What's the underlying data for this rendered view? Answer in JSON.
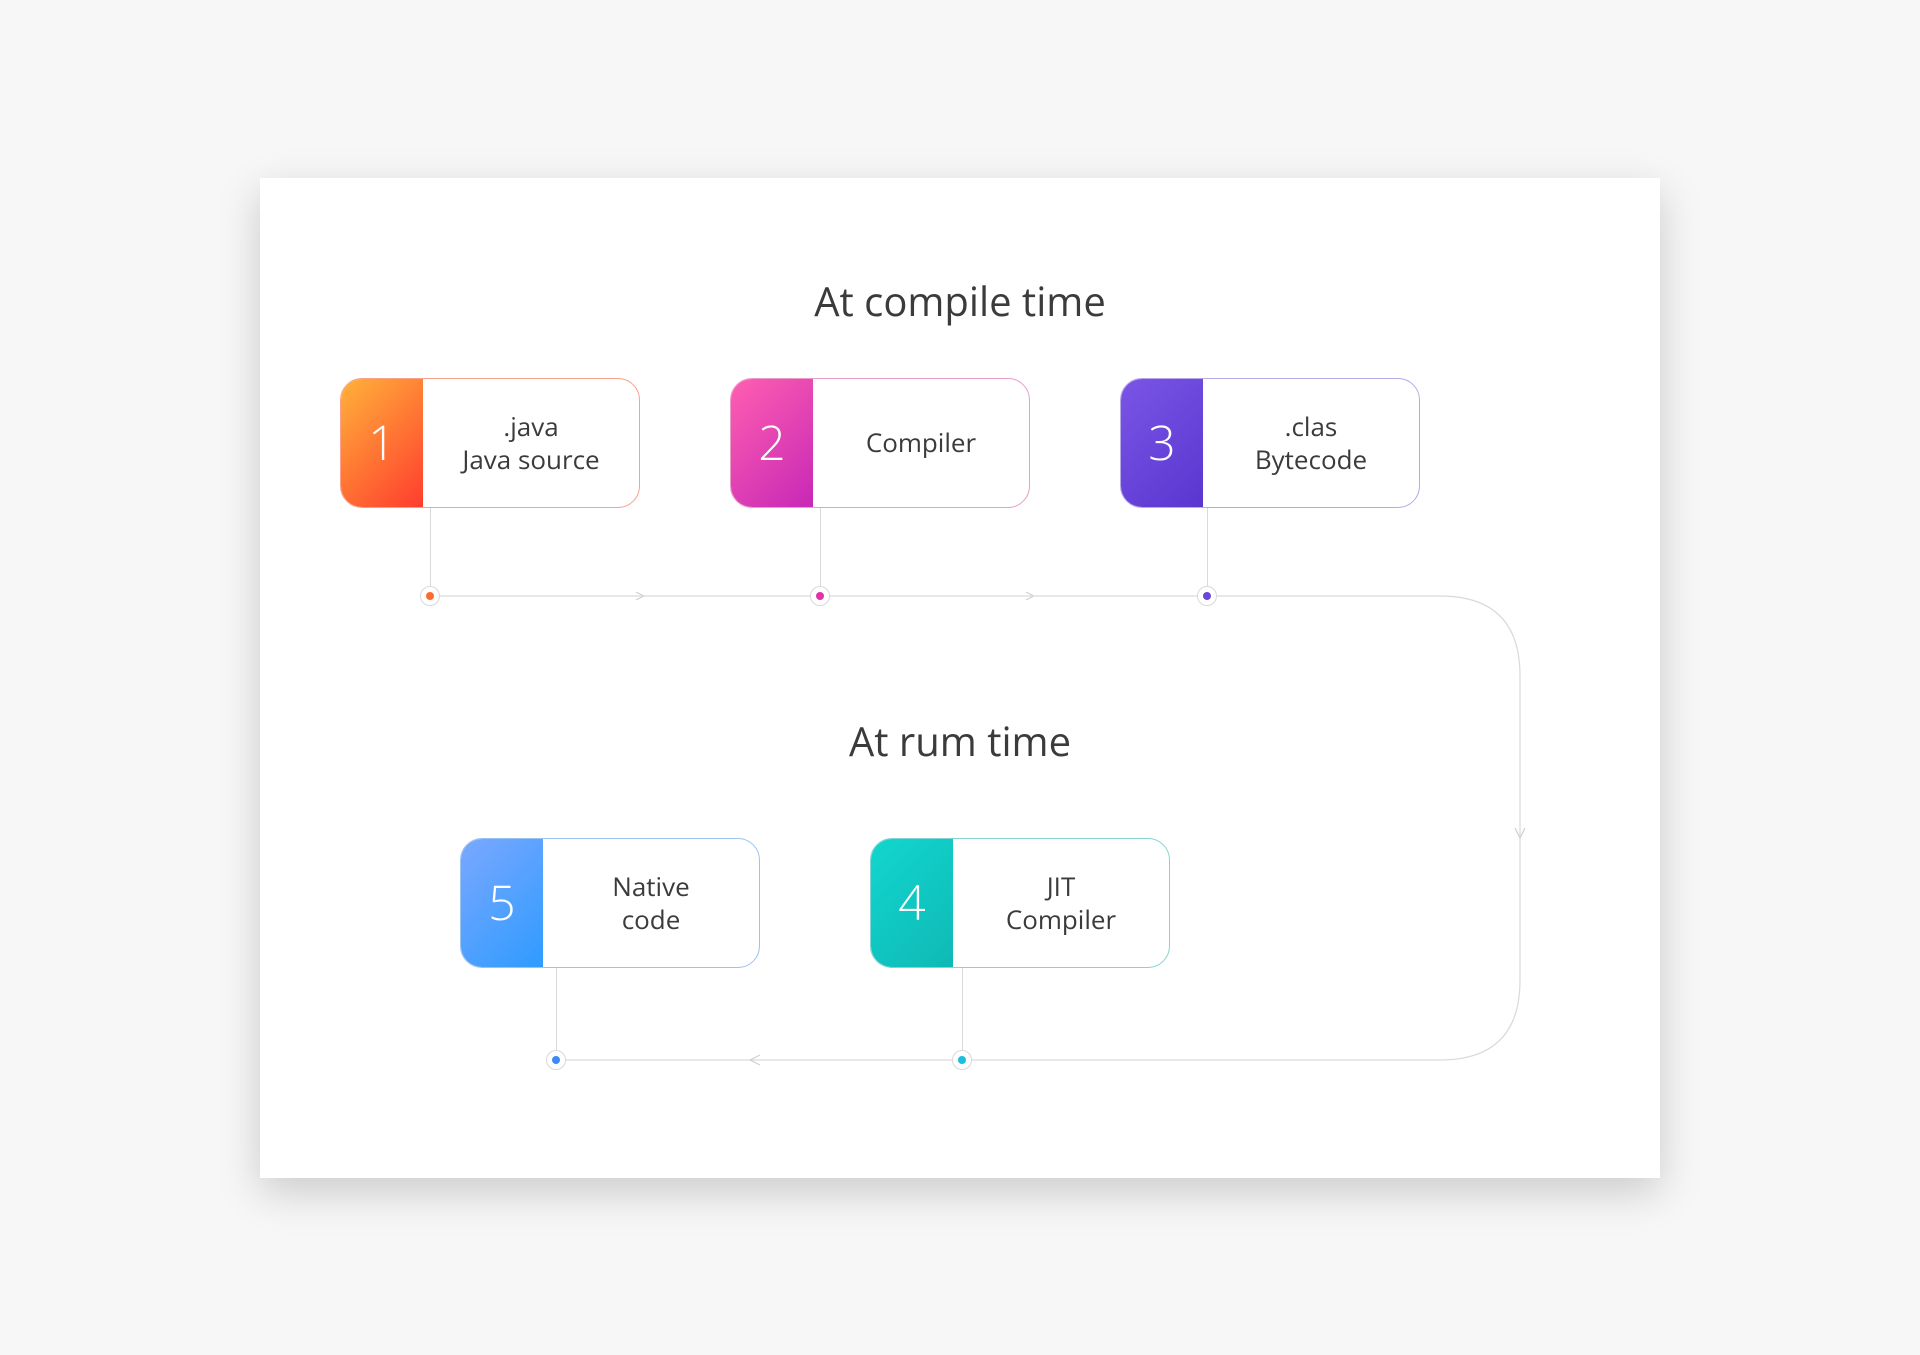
{
  "sections": {
    "top_title": "At compile time",
    "bottom_title": "At rum time"
  },
  "steps": [
    {
      "num": "1",
      "label": ".java\nJava source",
      "grad_from": "#ffb23a",
      "grad_to": "#ff3d2e",
      "border": "#f9a18c",
      "dot": "#ff6a2c"
    },
    {
      "num": "2",
      "label": "Compiler",
      "grad_from": "#ff5fb0",
      "grad_to": "#c728b6",
      "border": "#e89cc8",
      "dot": "#e232a9"
    },
    {
      "num": "3",
      "label": ".clas\nBytecode",
      "grad_from": "#7a55e6",
      "grad_to": "#5a36d0",
      "border": "#b7a8e6",
      "dot": "#6a46dc"
    },
    {
      "num": "4",
      "label": "JIT\nCompiler",
      "grad_from": "#12d6cf",
      "grad_to": "#0fb9b5",
      "border": "#86d3d2",
      "dot": "#18bfe0"
    },
    {
      "num": "5",
      "label": "Native\ncode",
      "grad_from": "#7aa8ff",
      "grad_to": "#2f9bff",
      "border": "#9ac4ee",
      "dot": "#3c8af5"
    }
  ]
}
